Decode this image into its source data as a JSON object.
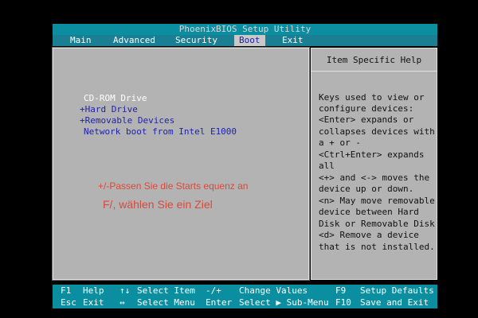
{
  "title": "PhoenixBIOS Setup Utility",
  "menu": [
    {
      "label": "Main"
    },
    {
      "label": "Advanced"
    },
    {
      "label": "Security"
    },
    {
      "label": "Boot",
      "active": true
    },
    {
      "label": "Exit"
    }
  ],
  "boot_items": [
    {
      "label": "CD-ROM Drive",
      "selected": true
    },
    {
      "label": "+Hard Drive"
    },
    {
      "label": "+Removable Devices"
    },
    {
      "label": "Network boot from Intel E1000"
    }
  ],
  "overlay": {
    "line1": "+/-Passen Sie die Starts equenz an",
    "line2": "F/, wählen Sie ein Ziel"
  },
  "help": {
    "title": "Item Specific Help",
    "lines": [
      "Keys used to view or",
      "configure devices:",
      "<Enter> expands or",
      "collapses devices with",
      "a + or -",
      "<Ctrl+Enter> expands",
      "all",
      "<+> and <-> moves the",
      "device up or down.",
      "<n> May move removable",
      "device between Hard",
      "Disk or Removable Disk",
      "<d> Remove a device",
      "that is not installed."
    ]
  },
  "footer": {
    "row1": [
      {
        "key": "F1",
        "desc": "Help"
      },
      {
        "key": "↑↓",
        "desc": "Select Item"
      },
      {
        "key": "-/+",
        "desc": "Change Values"
      },
      {
        "key": "F9",
        "desc": "Setup Defaults"
      }
    ],
    "row2": [
      {
        "key": "Esc",
        "desc": "Exit"
      },
      {
        "key": "↔",
        "desc": "Select Menu"
      },
      {
        "key": "Enter",
        "desc": "Select ▶ Sub-Menu"
      },
      {
        "key": "F10",
        "desc": "Save and Exit"
      }
    ]
  }
}
